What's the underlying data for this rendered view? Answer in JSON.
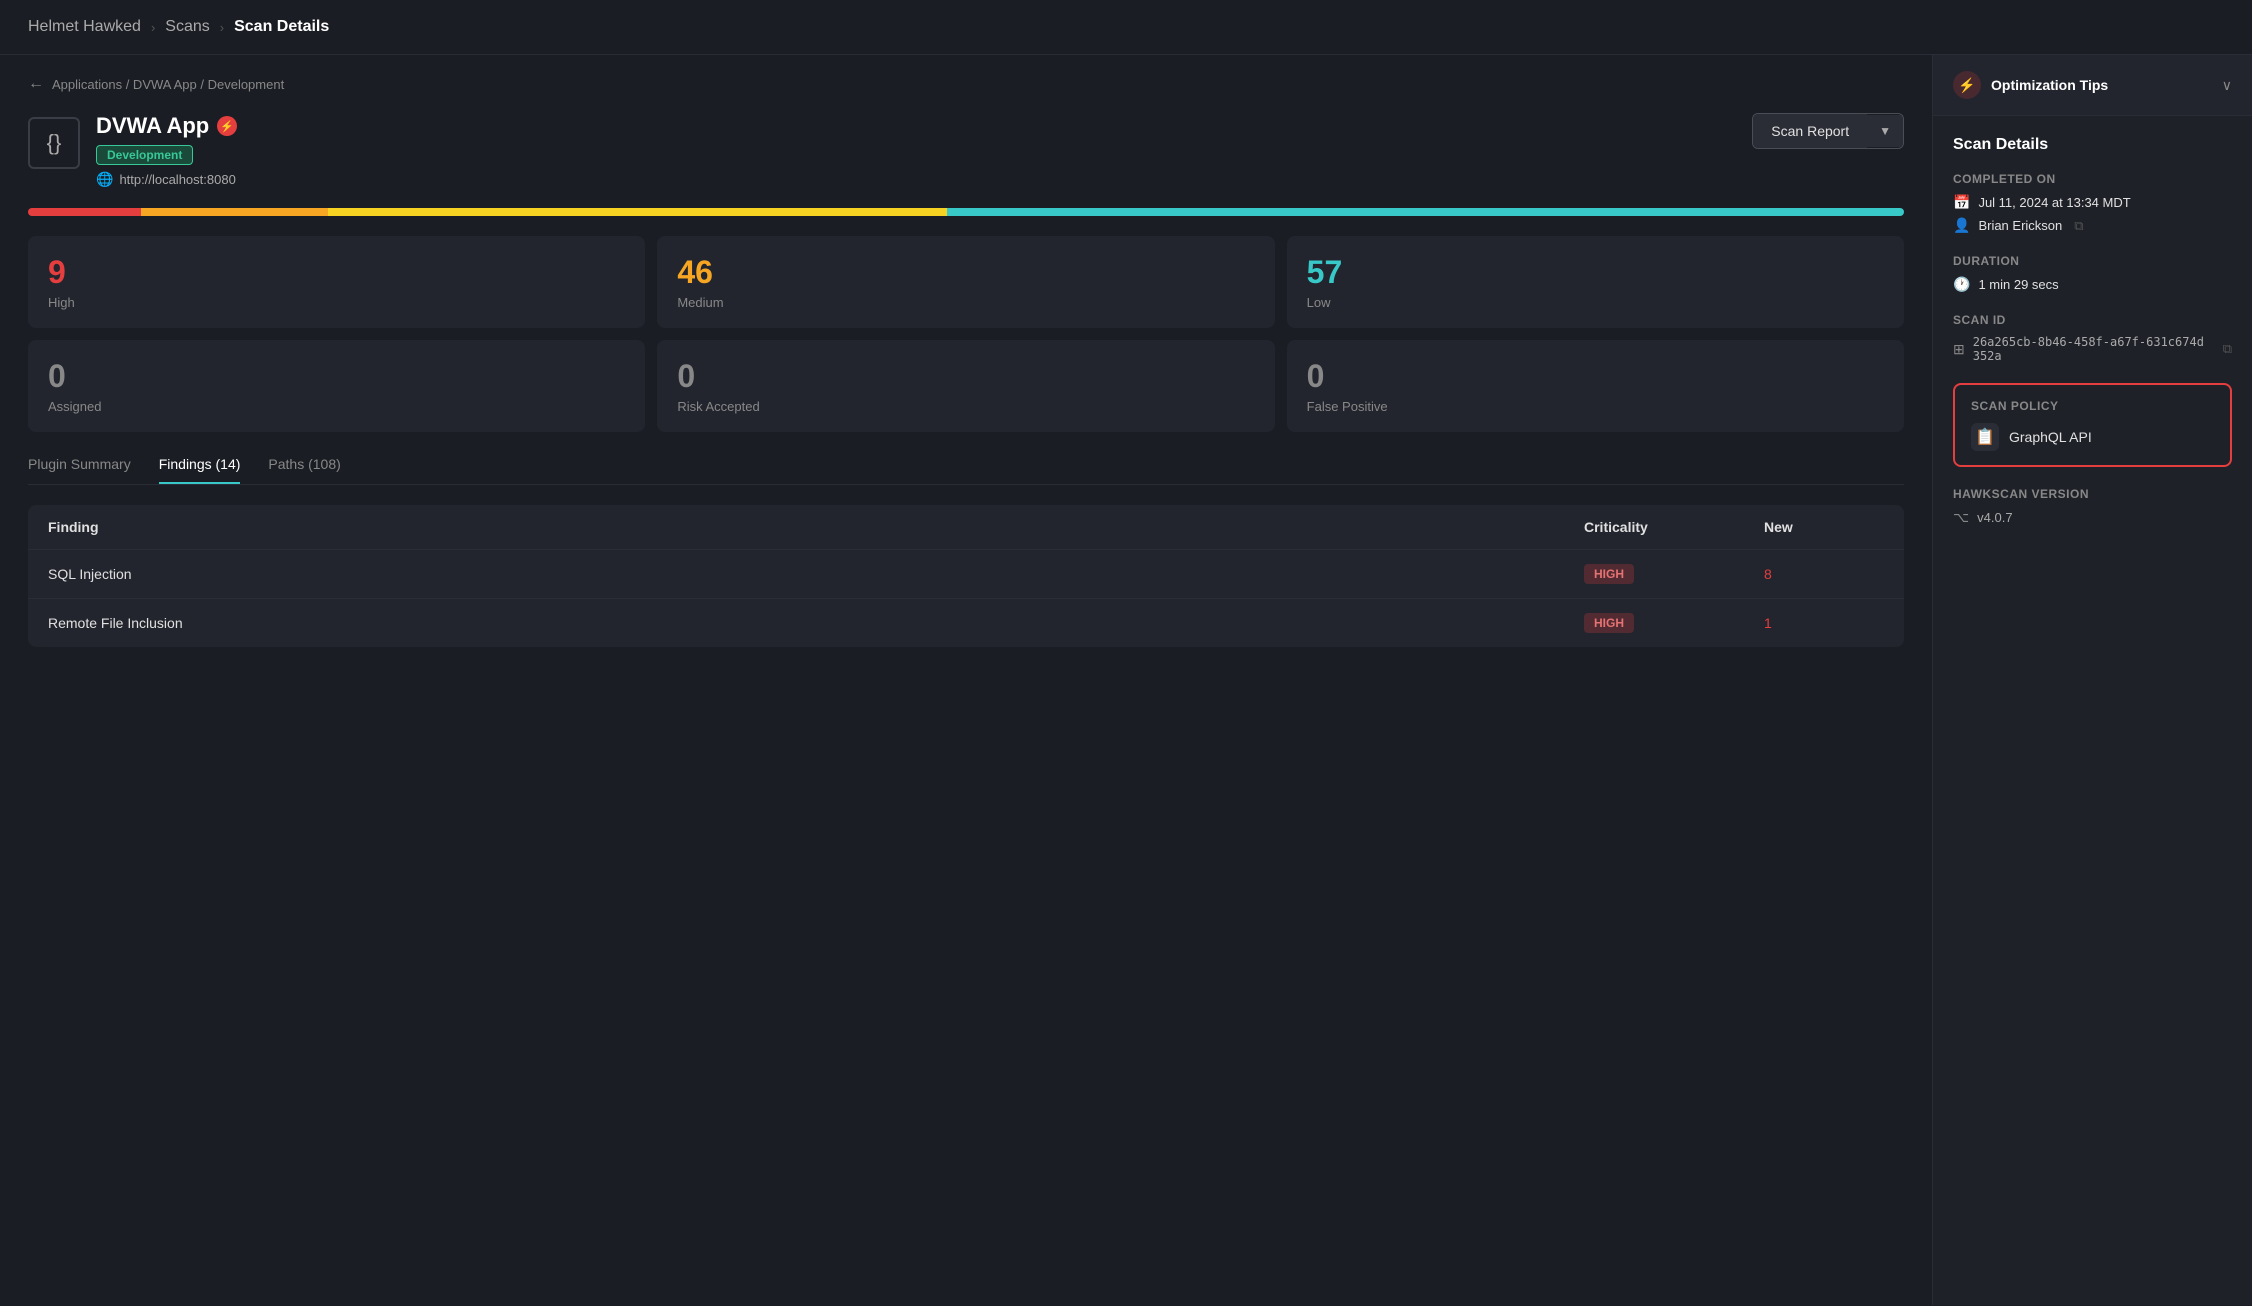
{
  "breadcrumb": {
    "brand": "Helmet Hawked",
    "scans": "Scans",
    "current": "Scan Details"
  },
  "back_nav": "Applications / DVWA App / Development",
  "app": {
    "name": "DVWA App",
    "env_badge": "Development",
    "url": "http://localhost:8080",
    "icon": "{}"
  },
  "buttons": {
    "scan_report": "Scan Report"
  },
  "stats": {
    "high": {
      "value": "9",
      "label": "High"
    },
    "medium": {
      "value": "46",
      "label": "Medium"
    },
    "low": {
      "value": "57",
      "label": "Low"
    },
    "assigned": {
      "value": "0",
      "label": "Assigned"
    },
    "risk_accepted": {
      "value": "0",
      "label": "Risk Accepted"
    },
    "false_positive": {
      "value": "0",
      "label": "False Positive"
    }
  },
  "tabs": [
    {
      "id": "plugin-summary",
      "label": "Plugin Summary"
    },
    {
      "id": "findings",
      "label": "Findings (14)"
    },
    {
      "id": "paths",
      "label": "Paths (108)"
    }
  ],
  "table": {
    "headers": {
      "finding": "Finding",
      "criticality": "Criticality",
      "new": "New"
    },
    "rows": [
      {
        "finding": "SQL Injection",
        "criticality": "HIGH",
        "new": "8"
      },
      {
        "finding": "Remote File Inclusion",
        "criticality": "HIGH",
        "new": "1"
      }
    ]
  },
  "sidebar": {
    "opt_tips": "Optimization Tips",
    "scan_details_title": "Scan Details",
    "completed_on_label": "Completed On",
    "completed_date": "Jul 11, 2024 at 13:34 MDT",
    "completed_user": "Brian Erickson",
    "duration_label": "Duration",
    "duration_value": "1 min 29 secs",
    "scan_id_label": "Scan ID",
    "scan_id_value": "26a265cb-8b46-458f-a67f-631c674d352a",
    "scan_policy_label": "Scan Policy",
    "scan_policy_value": "GraphQL API",
    "hawkscan_label": "HawkScan Version",
    "hawkscan_value": "v4.0.7"
  }
}
